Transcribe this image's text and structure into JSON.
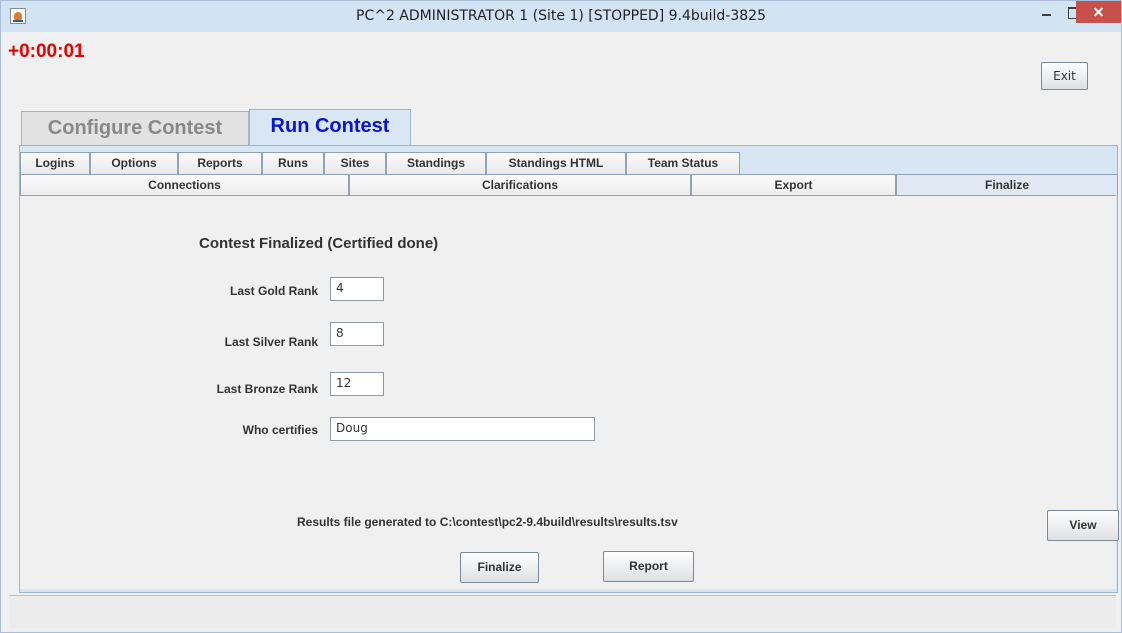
{
  "window": {
    "title": "PC^2 ADMINISTRATOR 1 (Site 1) [STOPPED] 9.4build-3825"
  },
  "header": {
    "clock": "+0:00:01",
    "exit_label": "Exit"
  },
  "main_tabs": [
    {
      "label": "Configure Contest",
      "active": false
    },
    {
      "label": "Run Contest",
      "active": true
    }
  ],
  "sub_tabs_row1": [
    {
      "label": "Logins"
    },
    {
      "label": "Options"
    },
    {
      "label": "Reports"
    },
    {
      "label": "Runs"
    },
    {
      "label": "Sites"
    },
    {
      "label": "Standings"
    },
    {
      "label": "Standings HTML"
    },
    {
      "label": "Team Status"
    }
  ],
  "sub_tabs_row2": [
    {
      "label": "Connections",
      "active": false
    },
    {
      "label": "Clarifications",
      "active": false
    },
    {
      "label": "Export",
      "active": false
    },
    {
      "label": "Finalize",
      "active": true
    }
  ],
  "finalize": {
    "heading": "Contest Finalized (Certified done)",
    "fields": [
      {
        "label": "Last Gold Rank",
        "value": "4"
      },
      {
        "label": "Last Silver Rank",
        "value": "8"
      },
      {
        "label": "Last Bronze Rank",
        "value": "12"
      },
      {
        "label": "Who certifies",
        "value": "Doug"
      }
    ],
    "results_text": "Results file generated to C:\\contest\\pc2-9.4build\\results\\results.tsv",
    "view_label": "View",
    "finalize_label": "Finalize",
    "report_label": "Report"
  },
  "colors": {
    "clock": "#e00000",
    "active_main_tab_text": "#0a14d8",
    "close_button": "#c7504a"
  }
}
